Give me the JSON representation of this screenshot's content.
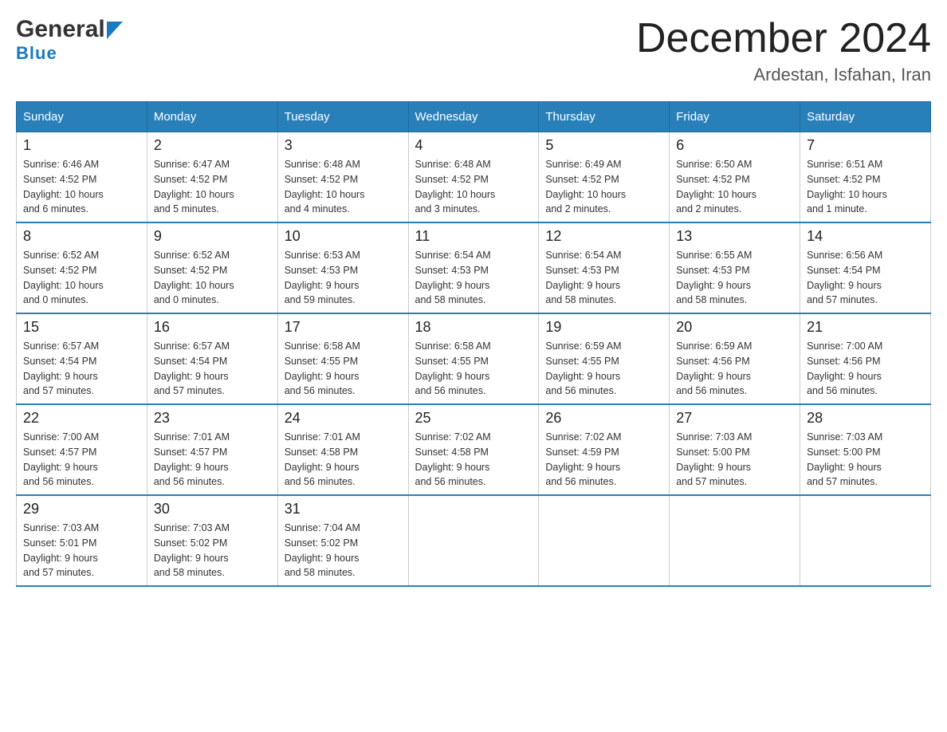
{
  "header": {
    "logo_general": "General",
    "logo_blue": "Blue",
    "month_title": "December 2024",
    "location": "Ardestan, Isfahan, Iran"
  },
  "weekdays": [
    "Sunday",
    "Monday",
    "Tuesday",
    "Wednesday",
    "Thursday",
    "Friday",
    "Saturday"
  ],
  "weeks": [
    [
      {
        "day": "1",
        "info": "Sunrise: 6:46 AM\nSunset: 4:52 PM\nDaylight: 10 hours\nand 6 minutes."
      },
      {
        "day": "2",
        "info": "Sunrise: 6:47 AM\nSunset: 4:52 PM\nDaylight: 10 hours\nand 5 minutes."
      },
      {
        "day": "3",
        "info": "Sunrise: 6:48 AM\nSunset: 4:52 PM\nDaylight: 10 hours\nand 4 minutes."
      },
      {
        "day": "4",
        "info": "Sunrise: 6:48 AM\nSunset: 4:52 PM\nDaylight: 10 hours\nand 3 minutes."
      },
      {
        "day": "5",
        "info": "Sunrise: 6:49 AM\nSunset: 4:52 PM\nDaylight: 10 hours\nand 2 minutes."
      },
      {
        "day": "6",
        "info": "Sunrise: 6:50 AM\nSunset: 4:52 PM\nDaylight: 10 hours\nand 2 minutes."
      },
      {
        "day": "7",
        "info": "Sunrise: 6:51 AM\nSunset: 4:52 PM\nDaylight: 10 hours\nand 1 minute."
      }
    ],
    [
      {
        "day": "8",
        "info": "Sunrise: 6:52 AM\nSunset: 4:52 PM\nDaylight: 10 hours\nand 0 minutes."
      },
      {
        "day": "9",
        "info": "Sunrise: 6:52 AM\nSunset: 4:52 PM\nDaylight: 10 hours\nand 0 minutes."
      },
      {
        "day": "10",
        "info": "Sunrise: 6:53 AM\nSunset: 4:53 PM\nDaylight: 9 hours\nand 59 minutes."
      },
      {
        "day": "11",
        "info": "Sunrise: 6:54 AM\nSunset: 4:53 PM\nDaylight: 9 hours\nand 58 minutes."
      },
      {
        "day": "12",
        "info": "Sunrise: 6:54 AM\nSunset: 4:53 PM\nDaylight: 9 hours\nand 58 minutes."
      },
      {
        "day": "13",
        "info": "Sunrise: 6:55 AM\nSunset: 4:53 PM\nDaylight: 9 hours\nand 58 minutes."
      },
      {
        "day": "14",
        "info": "Sunrise: 6:56 AM\nSunset: 4:54 PM\nDaylight: 9 hours\nand 57 minutes."
      }
    ],
    [
      {
        "day": "15",
        "info": "Sunrise: 6:57 AM\nSunset: 4:54 PM\nDaylight: 9 hours\nand 57 minutes."
      },
      {
        "day": "16",
        "info": "Sunrise: 6:57 AM\nSunset: 4:54 PM\nDaylight: 9 hours\nand 57 minutes."
      },
      {
        "day": "17",
        "info": "Sunrise: 6:58 AM\nSunset: 4:55 PM\nDaylight: 9 hours\nand 56 minutes."
      },
      {
        "day": "18",
        "info": "Sunrise: 6:58 AM\nSunset: 4:55 PM\nDaylight: 9 hours\nand 56 minutes."
      },
      {
        "day": "19",
        "info": "Sunrise: 6:59 AM\nSunset: 4:55 PM\nDaylight: 9 hours\nand 56 minutes."
      },
      {
        "day": "20",
        "info": "Sunrise: 6:59 AM\nSunset: 4:56 PM\nDaylight: 9 hours\nand 56 minutes."
      },
      {
        "day": "21",
        "info": "Sunrise: 7:00 AM\nSunset: 4:56 PM\nDaylight: 9 hours\nand 56 minutes."
      }
    ],
    [
      {
        "day": "22",
        "info": "Sunrise: 7:00 AM\nSunset: 4:57 PM\nDaylight: 9 hours\nand 56 minutes."
      },
      {
        "day": "23",
        "info": "Sunrise: 7:01 AM\nSunset: 4:57 PM\nDaylight: 9 hours\nand 56 minutes."
      },
      {
        "day": "24",
        "info": "Sunrise: 7:01 AM\nSunset: 4:58 PM\nDaylight: 9 hours\nand 56 minutes."
      },
      {
        "day": "25",
        "info": "Sunrise: 7:02 AM\nSunset: 4:58 PM\nDaylight: 9 hours\nand 56 minutes."
      },
      {
        "day": "26",
        "info": "Sunrise: 7:02 AM\nSunset: 4:59 PM\nDaylight: 9 hours\nand 56 minutes."
      },
      {
        "day": "27",
        "info": "Sunrise: 7:03 AM\nSunset: 5:00 PM\nDaylight: 9 hours\nand 57 minutes."
      },
      {
        "day": "28",
        "info": "Sunrise: 7:03 AM\nSunset: 5:00 PM\nDaylight: 9 hours\nand 57 minutes."
      }
    ],
    [
      {
        "day": "29",
        "info": "Sunrise: 7:03 AM\nSunset: 5:01 PM\nDaylight: 9 hours\nand 57 minutes."
      },
      {
        "day": "30",
        "info": "Sunrise: 7:03 AM\nSunset: 5:02 PM\nDaylight: 9 hours\nand 58 minutes."
      },
      {
        "day": "31",
        "info": "Sunrise: 7:04 AM\nSunset: 5:02 PM\nDaylight: 9 hours\nand 58 minutes."
      },
      {
        "day": "",
        "info": ""
      },
      {
        "day": "",
        "info": ""
      },
      {
        "day": "",
        "info": ""
      },
      {
        "day": "",
        "info": ""
      }
    ]
  ]
}
